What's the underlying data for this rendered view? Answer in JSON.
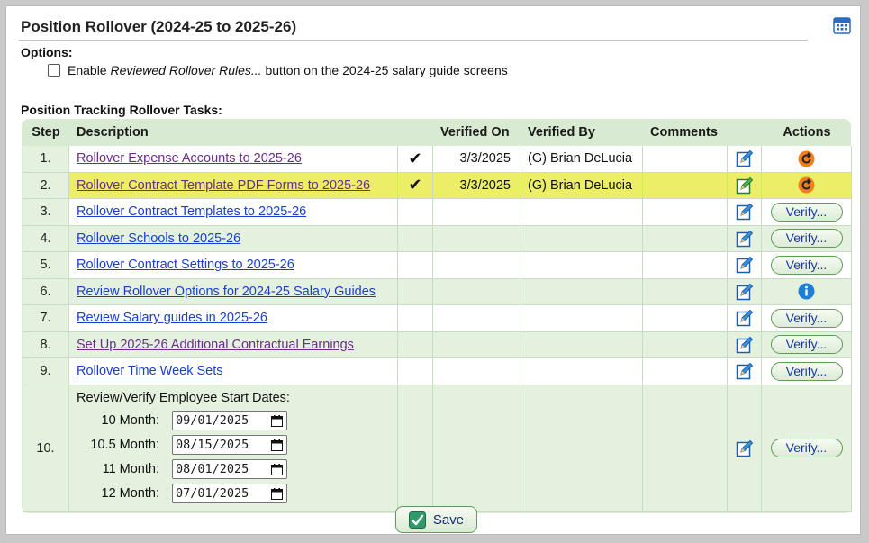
{
  "title": "Position Rollover (2024-25 to 2025-26)",
  "options": {
    "label": "Options:",
    "checkbox_prefix": "Enable ",
    "checkbox_em": "Reviewed Rollover Rules...",
    "checkbox_suffix": " button on the 2024-25 salary guide screens",
    "checked": false
  },
  "tasks_label": "Position Tracking Rollover Tasks:",
  "columns": {
    "step": "Step",
    "description": "Description",
    "verified_on": "Verified On",
    "verified_by": "Verified By",
    "comments": "Comments",
    "actions": "Actions"
  },
  "rows": [
    {
      "step": "1.",
      "description": "Rollover Expense Accounts to 2025-26",
      "check": "✔",
      "verified_on": "3/3/2025",
      "verified_by": "(G) Brian DeLucia",
      "action": "undo-icon"
    },
    {
      "step": "2.",
      "description": "Rollover Contract Template PDF Forms to 2025-26",
      "check": "✔",
      "verified_on": "3/3/2025",
      "verified_by": "(G) Brian DeLucia",
      "action": "undo-icon",
      "highlighted": true
    },
    {
      "step": "3.",
      "description": "Rollover Contract Templates to 2025-26",
      "action_label": "Verify..."
    },
    {
      "step": "4.",
      "description": "Rollover Schools to 2025-26",
      "action_label": "Verify..."
    },
    {
      "step": "5.",
      "description": "Rollover Contract Settings to 2025-26",
      "action_label": "Verify..."
    },
    {
      "step": "6.",
      "description": "Review Rollover Options for 2024-25 Salary Guides",
      "action": "info-icon"
    },
    {
      "step": "7.",
      "description": "Review Salary guides in 2025-26",
      "action_label": "Verify..."
    },
    {
      "step": "8.",
      "description": "Set Up 2025-26 Additional Contractual Earnings",
      "action_label": "Verify..."
    },
    {
      "step": "9.",
      "description": "Rollover Time Week Sets",
      "action_label": "Verify..."
    }
  ],
  "row10": {
    "step": "10.",
    "heading": "Review/Verify Employee Start Dates:",
    "dates": [
      {
        "label": "10 Month:",
        "value": "09/01/2025"
      },
      {
        "label": "10.5 Month:",
        "value": "08/15/2025"
      },
      {
        "label": "11 Month:",
        "value": "08/01/2025"
      },
      {
        "label": "12 Month:",
        "value": "07/01/2025"
      }
    ],
    "action_label": "Verify..."
  },
  "save_label": "Save",
  "colors": {
    "grid_bg": "#d8ead2",
    "highlight": "#ecee66",
    "link": "#1a3fcf",
    "visited_link": "#6b2d8a",
    "undo_orange": "#f07f1c",
    "info_blue": "#1e7fd8"
  }
}
